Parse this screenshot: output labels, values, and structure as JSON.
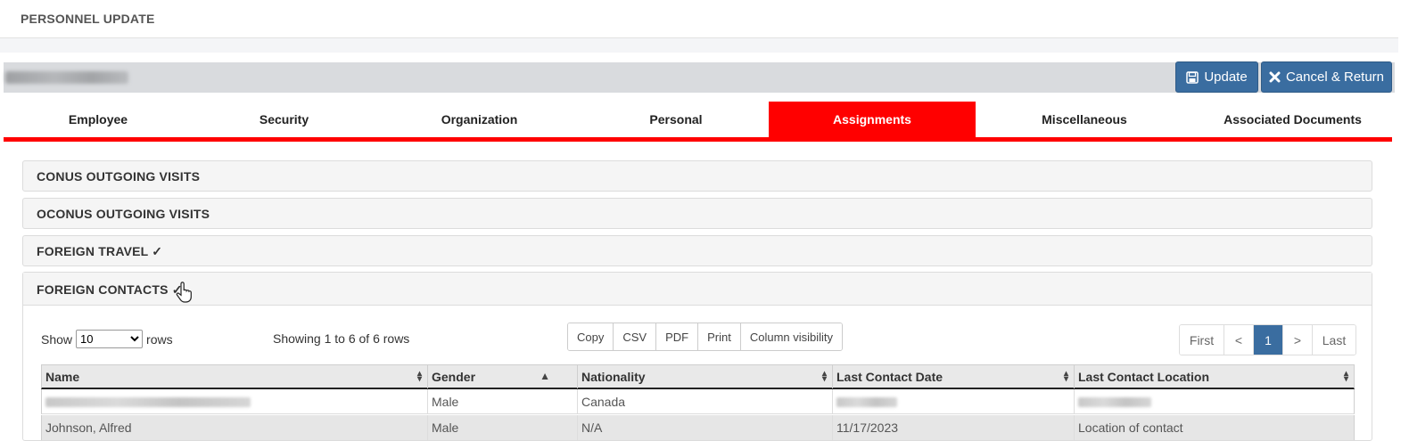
{
  "header": {
    "title": "PERSONNEL UPDATE"
  },
  "actions": {
    "update_label": "Update",
    "cancel_label": "Cancel & Return"
  },
  "tabs": [
    {
      "label": "Employee"
    },
    {
      "label": "Security"
    },
    {
      "label": "Organization"
    },
    {
      "label": "Personal"
    },
    {
      "label": "Assignments"
    },
    {
      "label": "Miscellaneous"
    },
    {
      "label": "Associated Documents"
    }
  ],
  "active_tab": "Assignments",
  "sections": [
    {
      "title": "CONUS OUTGOING VISITS"
    },
    {
      "title": "OCONUS OUTGOING VISITS"
    },
    {
      "title": "FOREIGN TRAVEL ✓"
    },
    {
      "title": "FOREIGN CONTACTS ✓"
    }
  ],
  "table_controls": {
    "show_label": "Show",
    "page_size": "10",
    "rows_label": "rows",
    "showing_text": "Showing 1 to 6 of 6 rows",
    "export_buttons": [
      "Copy",
      "CSV",
      "PDF",
      "Print",
      "Column visibility"
    ],
    "pager": {
      "first": "First",
      "prev": "<",
      "current": "1",
      "next": ">",
      "last": "Last"
    }
  },
  "table": {
    "columns": [
      "Name",
      "Gender",
      "Nationality",
      "Last Contact Date",
      "Last Contact Location"
    ],
    "rows": [
      [
        "",
        "Male",
        "Canada",
        "",
        ""
      ],
      [
        "Johnson, Alfred",
        "Male",
        "N/A",
        "11/17/2023",
        "Location of contact"
      ]
    ]
  },
  "colors": {
    "accent": "#ff0000",
    "primary_button": "#3a6da0"
  },
  "icons": [
    "save-icon",
    "close-icon",
    "sort-icon",
    "sort-asc-icon",
    "hand-cursor-icon"
  ]
}
